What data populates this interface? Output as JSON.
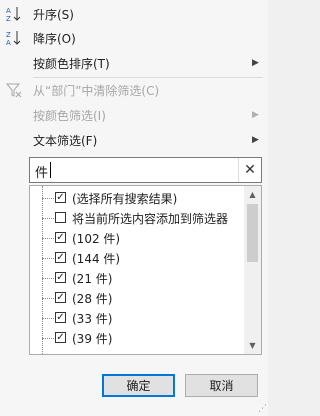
{
  "menu": {
    "sort_asc": "升序(S)",
    "sort_desc": "降序(O)",
    "sort_color": "按颜色排序(T)",
    "clear_filter": "从“部门”中清除筛选(C)",
    "filter_color": "按颜色筛选(I)",
    "text_filter": "文本筛选(F)",
    "icons": {
      "sort_asc": "sort-az-icon",
      "sort_desc": "sort-za-icon",
      "clear_filter": "clear-filter-icon"
    }
  },
  "search": {
    "value": "件",
    "clear_label": "✕"
  },
  "list": {
    "items": [
      {
        "label": "(选择所有搜索结果)",
        "checked": true
      },
      {
        "label": "将当前所选内容添加到筛选器",
        "checked": false
      },
      {
        "label": "(102 件)",
        "checked": true
      },
      {
        "label": "(144 件)",
        "checked": true
      },
      {
        "label": "(21 件)",
        "checked": true
      },
      {
        "label": "(28 件)",
        "checked": true
      },
      {
        "label": "(33 件)",
        "checked": true
      },
      {
        "label": "(39 件)",
        "checked": true
      }
    ]
  },
  "buttons": {
    "ok": "确定",
    "cancel": "取消"
  },
  "colors": {
    "accent": "#0078d7",
    "disabled": "#a6a6a6"
  }
}
